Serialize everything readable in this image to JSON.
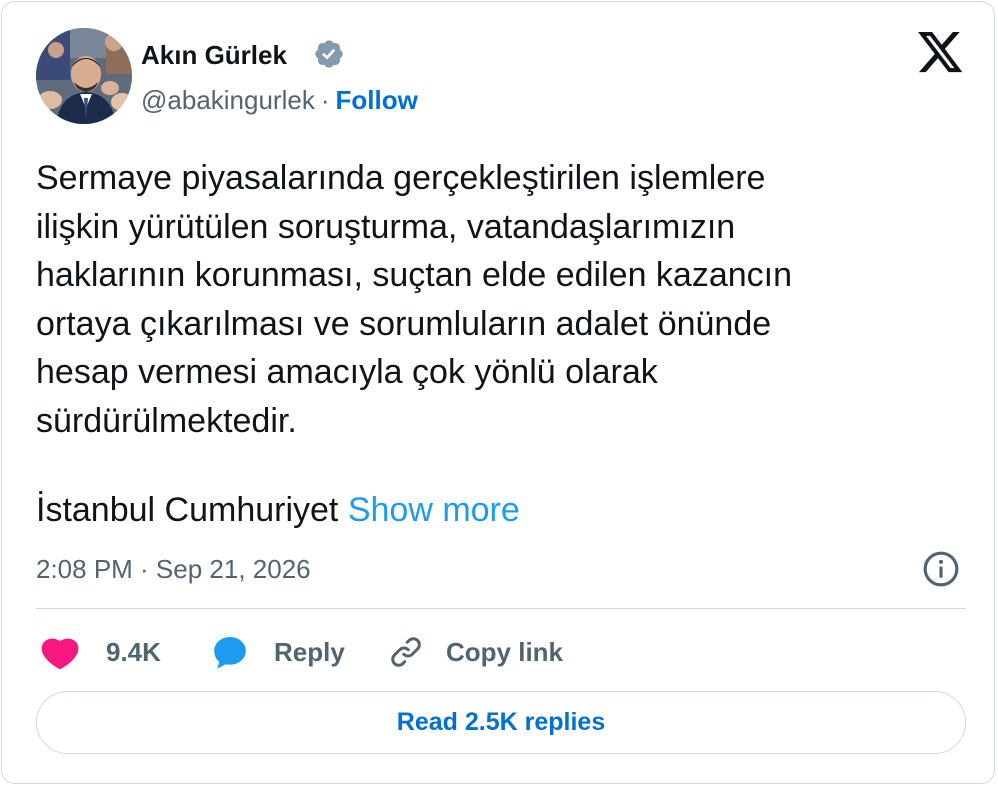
{
  "author": {
    "name": "Akın Gürlek",
    "handle": "@abakingurlek",
    "separator": "·",
    "follow_label": "Follow",
    "verified_icon": "verified-badge-icon"
  },
  "brand": {
    "logo_icon": "x-logo-icon"
  },
  "tweet": {
    "text": "Sermaye piyasalarında gerçekleştirilen işlemlere\nilişkin yürütülen soruşturma, vatandaşlarımızın\nhaklarının korunması, suçtan elde edilen kazancın\nortaya çıkarılması ve sorumluların adalet önünde\nhesap vermesi amacıyla çok yönlü olarak\nsürdürülmektedir.",
    "truncated_text": "İstanbul Cumhuriyet",
    "show_more_label": "Show more",
    "timestamp": "2:08 PM · Sep 21, 2026"
  },
  "actions": {
    "like_count": "9.4K",
    "reply_label": "Reply",
    "copy_link_label": "Copy link",
    "read_replies_label": "Read 2.5K replies"
  },
  "colors": {
    "like": "#f91880",
    "reply_icon": "#1d9bf0",
    "link": "#006fd6",
    "show_more": "#1d9bf0",
    "muted": "#536471",
    "verified": "#829aab",
    "border": "#cfd9de"
  }
}
